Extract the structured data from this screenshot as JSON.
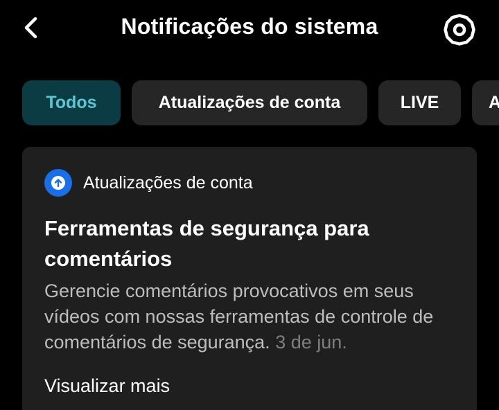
{
  "header": {
    "title": "Notificações do sistema",
    "back_icon": "chevron-left-icon",
    "settings_icon": "gear-icon"
  },
  "tabs": [
    {
      "label": "Todos",
      "active": true
    },
    {
      "label": "Atualizações de conta",
      "active": false
    },
    {
      "label": "LIVE",
      "active": false
    },
    {
      "label": "A",
      "active": false
    }
  ],
  "notification": {
    "category_icon": "arrow-up-circle-icon",
    "category": "Atualizações de conta",
    "title": "Ferramentas de segurança para comentários",
    "body": "Gerencie comentários provocativos em seus vídeos com nossas ferramentas de controle de comentários de segurança.",
    "date": "3 de jun.",
    "link": "Visualizar mais"
  },
  "colors": {
    "background": "#000000",
    "surface": "#1f1f1f",
    "tab_background": "#262626",
    "active_tab_background": "#0b3c44",
    "active_tab_text": "#5cc6d3",
    "category_badge": "#1b6fe6",
    "body_text": "#bdbdbd",
    "date_text": "#7f7f7f"
  }
}
